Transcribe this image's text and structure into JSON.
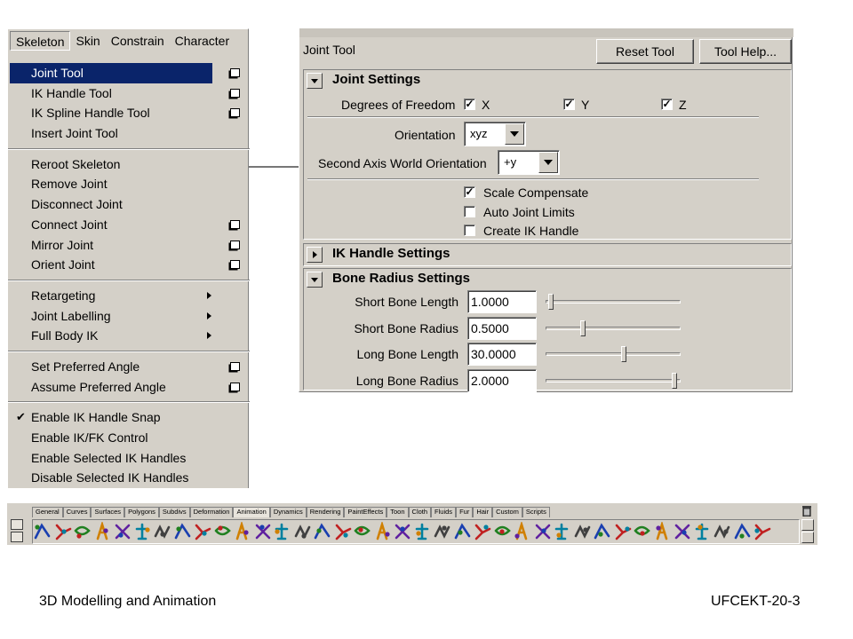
{
  "menubar": {
    "items": [
      "Skeleton",
      "Skin",
      "Constrain",
      "Character"
    ]
  },
  "skeleton_menu": {
    "groups": [
      [
        {
          "label": "Joint Tool",
          "option_box": true,
          "highlighted": true
        },
        {
          "label": "IK Handle Tool",
          "option_box": true
        },
        {
          "label": "IK Spline Handle Tool",
          "option_box": true
        },
        {
          "label": "Insert Joint Tool",
          "option_box": false
        }
      ],
      [
        {
          "label": "Reroot Skeleton"
        },
        {
          "label": "Remove Joint"
        },
        {
          "label": "Disconnect Joint"
        },
        {
          "label": "Connect Joint",
          "option_box": true
        },
        {
          "label": "Mirror Joint",
          "option_box": true
        },
        {
          "label": "Orient Joint",
          "option_box": true
        }
      ],
      [
        {
          "label": "Retargeting",
          "submenu": true
        },
        {
          "label": "Joint Labelling",
          "submenu": true
        },
        {
          "label": "Full Body IK",
          "submenu": true
        }
      ],
      [
        {
          "label": "Set Preferred Angle",
          "option_box": true
        },
        {
          "label": "Assume Preferred Angle",
          "option_box": true
        }
      ],
      [
        {
          "label": "Enable IK Handle Snap",
          "checked": true
        },
        {
          "label": "Enable IK/FK Control"
        },
        {
          "label": "Enable Selected IK Handles"
        },
        {
          "label": "Disable Selected IK Handles"
        }
      ]
    ]
  },
  "tool_settings": {
    "title": "Joint Tool",
    "reset_label": "Reset Tool",
    "help_label": "Tool Help...",
    "joint_settings": {
      "title": "Joint Settings",
      "dof_label": "Degrees of Freedom",
      "dof": [
        {
          "label": "X",
          "checked": true
        },
        {
          "label": "Y",
          "checked": true
        },
        {
          "label": "Z",
          "checked": true
        }
      ],
      "orientation_label": "Orientation",
      "orientation_value": "xyz",
      "second_axis_label": "Second Axis World Orientation",
      "second_axis_value": "+y",
      "options": [
        {
          "label": "Scale Compensate",
          "checked": true
        },
        {
          "label": "Auto Joint Limits",
          "checked": false
        },
        {
          "label": "Create IK Handle",
          "checked": false
        }
      ]
    },
    "ik_handle_settings": {
      "title": "IK Handle Settings"
    },
    "bone_radius_settings": {
      "title": "Bone Radius Settings",
      "rows": [
        {
          "label": "Short Bone Length",
          "value": "1.0000",
          "slider": 0.03
        },
        {
          "label": "Short Bone Radius",
          "value": "0.5000",
          "slider": 0.27
        },
        {
          "label": "Long Bone Length",
          "value": "30.0000",
          "slider": 0.58
        },
        {
          "label": "Long Bone Radius",
          "value": "2.0000",
          "slider": 0.96
        }
      ]
    }
  },
  "shelf": {
    "tabs": [
      "General",
      "Curves",
      "Surfaces",
      "Polygons",
      "Subdivs",
      "Deformation",
      "Animation",
      "Dynamics",
      "Rendering",
      "PaintEffects",
      "Toon",
      "Cloth",
      "Fluids",
      "Fur",
      "Hair",
      "Custom",
      "Scripts"
    ],
    "active_tab": "Animation"
  },
  "footer": {
    "left": "3D Modelling and Animation",
    "right": "UFCEKT-20-3"
  }
}
